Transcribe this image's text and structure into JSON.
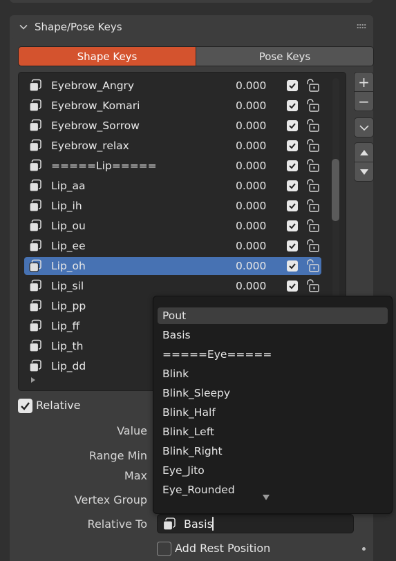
{
  "panel": {
    "title": "Shape/Pose Keys"
  },
  "tabs": [
    {
      "label": "Shape Keys",
      "active": true
    },
    {
      "label": "Pose Keys",
      "active": false
    }
  ],
  "shape_keys": [
    {
      "name": "Eyebrow_Angry",
      "value": "0.000",
      "selected": false
    },
    {
      "name": "Eyebrow_Komari",
      "value": "0.000",
      "selected": false
    },
    {
      "name": "Eyebrow_Sorrow",
      "value": "0.000",
      "selected": false
    },
    {
      "name": "Eyebrow_relax",
      "value": "0.000",
      "selected": false
    },
    {
      "name": "=====Lip=====",
      "value": "0.000",
      "selected": false
    },
    {
      "name": "Lip_aa",
      "value": "0.000",
      "selected": false
    },
    {
      "name": "Lip_ih",
      "value": "0.000",
      "selected": false
    },
    {
      "name": "Lip_ou",
      "value": "0.000",
      "selected": false
    },
    {
      "name": "Lip_ee",
      "value": "0.000",
      "selected": false
    },
    {
      "name": "Lip_oh",
      "value": "0.000",
      "selected": true
    },
    {
      "name": "Lip_sil",
      "value": "0.000",
      "selected": false
    },
    {
      "name": "Lip_pp",
      "value": "",
      "selected": false
    },
    {
      "name": "Lip_ff",
      "value": "",
      "selected": false
    },
    {
      "name": "Lip_th",
      "value": "",
      "selected": false
    },
    {
      "name": "Lip_dd",
      "value": "",
      "selected": false
    }
  ],
  "side_buttons": {
    "add": "+",
    "remove": "−"
  },
  "properties": {
    "relative_label": "Relative",
    "relative_checked": true,
    "value_label": "Value",
    "range_min_label": "Range Min",
    "max_label": "Max",
    "vertex_group_label": "Vertex Group",
    "relative_to_label": "Relative To",
    "relative_to_value": "Basis",
    "add_rest_position_label": "Add Rest Position",
    "add_rest_position_checked": false
  },
  "dropdown": {
    "items": [
      {
        "label": "Pout",
        "hover": true
      },
      {
        "label": "Basis",
        "hover": false
      },
      {
        "label": "=====Eye=====",
        "hover": false
      },
      {
        "label": "Blink",
        "hover": false
      },
      {
        "label": "Blink_Sleepy",
        "hover": false
      },
      {
        "label": "Blink_Half",
        "hover": false
      },
      {
        "label": "Blink_Left",
        "hover": false
      },
      {
        "label": "Blink_Right",
        "hover": false
      },
      {
        "label": "Eye_Jito",
        "hover": false
      },
      {
        "label": "Eye_Rounded",
        "hover": false
      }
    ]
  },
  "colors": {
    "accent_tab": "#d4532e",
    "selection": "#4772b3",
    "panel": "#3d3d3d",
    "background": "#303030"
  }
}
